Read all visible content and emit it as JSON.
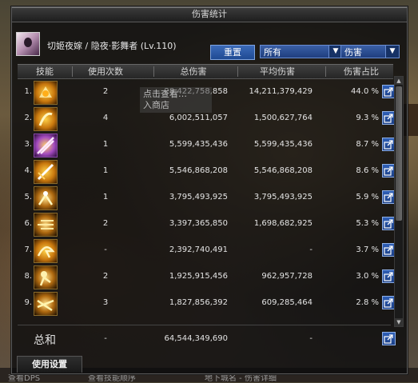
{
  "window": {
    "title": "伤害统计"
  },
  "header": {
    "character": "切姬夜嫁 / 隐夜·影舞者 (Lv.110)",
    "reset_label": "重置",
    "owner_filter": "所有",
    "type_filter": "伤害"
  },
  "columns": {
    "skill": "技能",
    "uses": "使用次数",
    "total": "总伤害",
    "avg": "平均伤害",
    "share": "伤害占比"
  },
  "rows": [
    {
      "rank": "1.",
      "uses": "2",
      "total": "28,422,758,858",
      "avg": "14,211,379,429",
      "share": "44.0 %"
    },
    {
      "rank": "2.",
      "uses": "4",
      "total": "6,002,511,057",
      "avg": "1,500,627,764",
      "share": "9.3 %"
    },
    {
      "rank": "3.",
      "uses": "1",
      "total": "5,599,435,436",
      "avg": "5,599,435,436",
      "share": "8.7 %"
    },
    {
      "rank": "4.",
      "uses": "1",
      "total": "5,546,868,208",
      "avg": "5,546,868,208",
      "share": "8.6 %"
    },
    {
      "rank": "5.",
      "uses": "1",
      "total": "3,795,493,925",
      "avg": "3,795,493,925",
      "share": "5.9 %"
    },
    {
      "rank": "6.",
      "uses": "2",
      "total": "3,397,365,850",
      "avg": "1,698,682,925",
      "share": "5.3 %"
    },
    {
      "rank": "7.",
      "uses": "-",
      "total": "2,392,740,491",
      "avg": "-",
      "share": "3.7 %"
    },
    {
      "rank": "8.",
      "uses": "2",
      "total": "1,925,915,456",
      "avg": "962,957,728",
      "share": "3.0 %"
    },
    {
      "rank": "9.",
      "uses": "3",
      "total": "1,827,856,392",
      "avg": "609,285,464",
      "share": "2.8 %"
    }
  ],
  "totals": {
    "label": "总和",
    "uses": "-",
    "total": "64,544,349,690",
    "avg": "-"
  },
  "footer": {
    "settings_tab": "使用设置"
  },
  "tooltip": {
    "line1": "点击查看…",
    "line2": "入商店"
  },
  "background": {
    "bottom_left": "查看DPS",
    "bottom_mid": "查看技能顺序",
    "bottom_right": "地下城名 - 伤害详细"
  },
  "icons": {
    "share": "share-icon",
    "scroll_up": "arrow-up-icon",
    "scroll_down": "arrow-down-icon",
    "dropdown": "chevron-down-icon"
  }
}
